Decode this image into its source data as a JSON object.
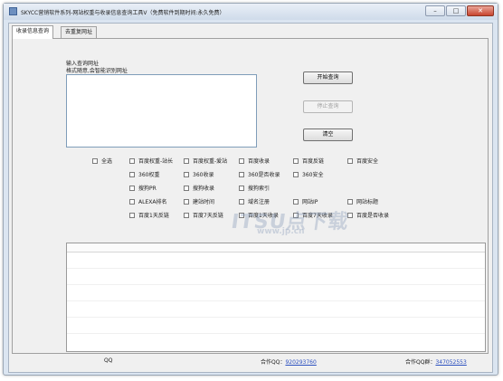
{
  "window": {
    "title": "SKYCC营销软件系列-网站权重与收录信息查询工具V（免费软件到期时间:永久免费）",
    "minimize": "–",
    "maximize": "□",
    "close": "✕"
  },
  "tabs": [
    {
      "label": "收录信息查询"
    },
    {
      "label": "去重复网址"
    }
  ],
  "input": {
    "label_line1": "输入查询网址",
    "label_line2": "格式随意,会智能识别网址",
    "value": ""
  },
  "buttons": {
    "start": "开始查询",
    "stop": "停止查询",
    "clear": "清空"
  },
  "options": {
    "select_all": "全选",
    "row1": [
      "百度权重-站长",
      "百度权重-爱站",
      "百度收录",
      "百度反链",
      "百度安全"
    ],
    "row2": [
      "360权重",
      "360收录",
      "360是否收录",
      "360安全"
    ],
    "row3": [
      "搜狗PR",
      "搜狗收录",
      "搜狗索引"
    ],
    "row4": [
      "ALEXA排名",
      "建站时间",
      "域名注册",
      "网站IP",
      "网站标题"
    ],
    "row5": [
      "百度1天反链",
      "百度7天反链",
      "百度1天收录",
      "百度7天收录",
      "百度是否收录"
    ]
  },
  "status": {
    "qq_label": "QQ",
    "partner_qq_label": "合作QQ：",
    "partner_qq_value": "920293760",
    "partner_qq_group_label": "合作QQ群：",
    "partner_qq_group_value": "347052553"
  },
  "watermark": {
    "text": "ITSU点下载",
    "sub": "www.jp.cn"
  },
  "colors": {
    "titlebar": "#cfdbea",
    "link": "#2b4fbf",
    "close_button": "#c8452f"
  }
}
